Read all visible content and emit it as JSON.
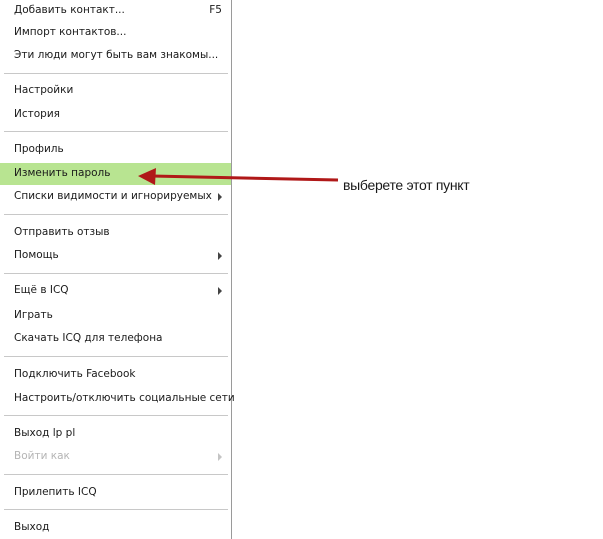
{
  "menu": {
    "items": [
      {
        "label": "Добавить контакт...",
        "shortcut": "F5"
      },
      {
        "label": "Импорт контактов..."
      },
      {
        "label": "Эти люди могут быть вам знакомы..."
      },
      {
        "label": "Настройки"
      },
      {
        "label": "История"
      },
      {
        "label": "Профиль"
      },
      {
        "label": "Изменить пароль"
      },
      {
        "label": "Списки видимости и игнорируемых"
      },
      {
        "label": "Отправить отзыв"
      },
      {
        "label": "Помощь"
      },
      {
        "label": "Ещё в ICQ"
      },
      {
        "label": "Играть"
      },
      {
        "label": "Скачать ICQ для телефона"
      },
      {
        "label": "Подключить Facebook"
      },
      {
        "label": "Настроить/отключить социальные сети"
      },
      {
        "label": "Выход lp pl"
      },
      {
        "label": "Войти как"
      },
      {
        "label": "Прилепить ICQ"
      },
      {
        "label": "Выход"
      }
    ]
  },
  "annotation": {
    "text": "выберете этот пункт",
    "arrow_color": "#b01818"
  },
  "colors": {
    "highlight": "#b8e491"
  }
}
